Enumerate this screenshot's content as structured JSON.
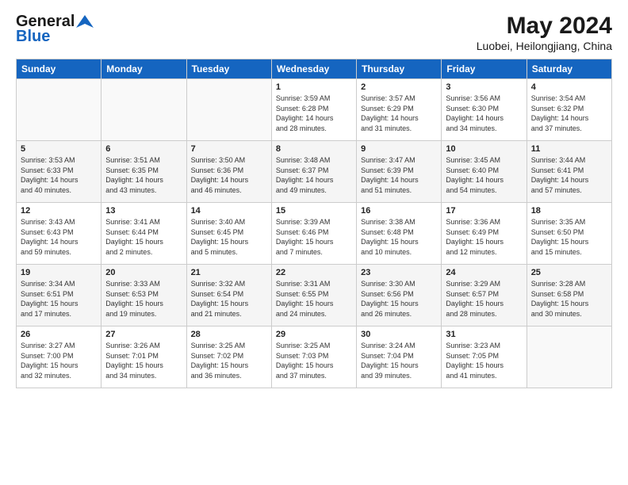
{
  "header": {
    "logo_general": "General",
    "logo_blue": "Blue",
    "month_title": "May 2024",
    "location": "Luobei, Heilongjiang, China"
  },
  "weekdays": [
    "Sunday",
    "Monday",
    "Tuesday",
    "Wednesday",
    "Thursday",
    "Friday",
    "Saturday"
  ],
  "weeks": [
    [
      {
        "day": "",
        "info": ""
      },
      {
        "day": "",
        "info": ""
      },
      {
        "day": "",
        "info": ""
      },
      {
        "day": "1",
        "info": "Sunrise: 3:59 AM\nSunset: 6:28 PM\nDaylight: 14 hours\nand 28 minutes."
      },
      {
        "day": "2",
        "info": "Sunrise: 3:57 AM\nSunset: 6:29 PM\nDaylight: 14 hours\nand 31 minutes."
      },
      {
        "day": "3",
        "info": "Sunrise: 3:56 AM\nSunset: 6:30 PM\nDaylight: 14 hours\nand 34 minutes."
      },
      {
        "day": "4",
        "info": "Sunrise: 3:54 AM\nSunset: 6:32 PM\nDaylight: 14 hours\nand 37 minutes."
      }
    ],
    [
      {
        "day": "5",
        "info": "Sunrise: 3:53 AM\nSunset: 6:33 PM\nDaylight: 14 hours\nand 40 minutes."
      },
      {
        "day": "6",
        "info": "Sunrise: 3:51 AM\nSunset: 6:35 PM\nDaylight: 14 hours\nand 43 minutes."
      },
      {
        "day": "7",
        "info": "Sunrise: 3:50 AM\nSunset: 6:36 PM\nDaylight: 14 hours\nand 46 minutes."
      },
      {
        "day": "8",
        "info": "Sunrise: 3:48 AM\nSunset: 6:37 PM\nDaylight: 14 hours\nand 49 minutes."
      },
      {
        "day": "9",
        "info": "Sunrise: 3:47 AM\nSunset: 6:39 PM\nDaylight: 14 hours\nand 51 minutes."
      },
      {
        "day": "10",
        "info": "Sunrise: 3:45 AM\nSunset: 6:40 PM\nDaylight: 14 hours\nand 54 minutes."
      },
      {
        "day": "11",
        "info": "Sunrise: 3:44 AM\nSunset: 6:41 PM\nDaylight: 14 hours\nand 57 minutes."
      }
    ],
    [
      {
        "day": "12",
        "info": "Sunrise: 3:43 AM\nSunset: 6:43 PM\nDaylight: 14 hours\nand 59 minutes."
      },
      {
        "day": "13",
        "info": "Sunrise: 3:41 AM\nSunset: 6:44 PM\nDaylight: 15 hours\nand 2 minutes."
      },
      {
        "day": "14",
        "info": "Sunrise: 3:40 AM\nSunset: 6:45 PM\nDaylight: 15 hours\nand 5 minutes."
      },
      {
        "day": "15",
        "info": "Sunrise: 3:39 AM\nSunset: 6:46 PM\nDaylight: 15 hours\nand 7 minutes."
      },
      {
        "day": "16",
        "info": "Sunrise: 3:38 AM\nSunset: 6:48 PM\nDaylight: 15 hours\nand 10 minutes."
      },
      {
        "day": "17",
        "info": "Sunrise: 3:36 AM\nSunset: 6:49 PM\nDaylight: 15 hours\nand 12 minutes."
      },
      {
        "day": "18",
        "info": "Sunrise: 3:35 AM\nSunset: 6:50 PM\nDaylight: 15 hours\nand 15 minutes."
      }
    ],
    [
      {
        "day": "19",
        "info": "Sunrise: 3:34 AM\nSunset: 6:51 PM\nDaylight: 15 hours\nand 17 minutes."
      },
      {
        "day": "20",
        "info": "Sunrise: 3:33 AM\nSunset: 6:53 PM\nDaylight: 15 hours\nand 19 minutes."
      },
      {
        "day": "21",
        "info": "Sunrise: 3:32 AM\nSunset: 6:54 PM\nDaylight: 15 hours\nand 21 minutes."
      },
      {
        "day": "22",
        "info": "Sunrise: 3:31 AM\nSunset: 6:55 PM\nDaylight: 15 hours\nand 24 minutes."
      },
      {
        "day": "23",
        "info": "Sunrise: 3:30 AM\nSunset: 6:56 PM\nDaylight: 15 hours\nand 26 minutes."
      },
      {
        "day": "24",
        "info": "Sunrise: 3:29 AM\nSunset: 6:57 PM\nDaylight: 15 hours\nand 28 minutes."
      },
      {
        "day": "25",
        "info": "Sunrise: 3:28 AM\nSunset: 6:58 PM\nDaylight: 15 hours\nand 30 minutes."
      }
    ],
    [
      {
        "day": "26",
        "info": "Sunrise: 3:27 AM\nSunset: 7:00 PM\nDaylight: 15 hours\nand 32 minutes."
      },
      {
        "day": "27",
        "info": "Sunrise: 3:26 AM\nSunset: 7:01 PM\nDaylight: 15 hours\nand 34 minutes."
      },
      {
        "day": "28",
        "info": "Sunrise: 3:25 AM\nSunset: 7:02 PM\nDaylight: 15 hours\nand 36 minutes."
      },
      {
        "day": "29",
        "info": "Sunrise: 3:25 AM\nSunset: 7:03 PM\nDaylight: 15 hours\nand 37 minutes."
      },
      {
        "day": "30",
        "info": "Sunrise: 3:24 AM\nSunset: 7:04 PM\nDaylight: 15 hours\nand 39 minutes."
      },
      {
        "day": "31",
        "info": "Sunrise: 3:23 AM\nSunset: 7:05 PM\nDaylight: 15 hours\nand 41 minutes."
      },
      {
        "day": "",
        "info": ""
      }
    ]
  ]
}
